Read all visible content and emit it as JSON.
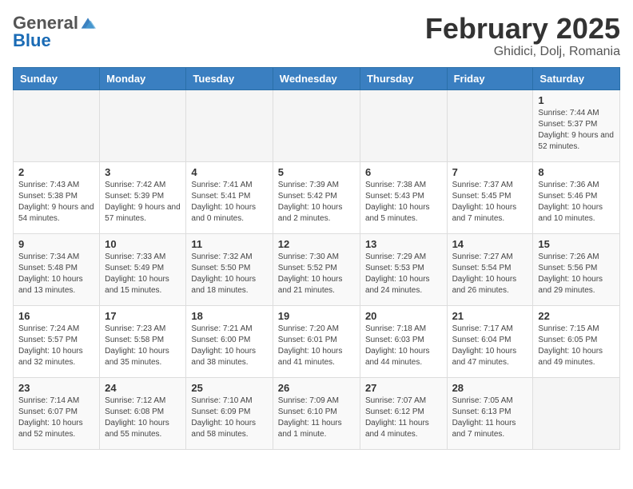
{
  "header": {
    "logo_general": "General",
    "logo_blue": "Blue",
    "month_title": "February 2025",
    "location": "Ghidici, Dolj, Romania"
  },
  "weekdays": [
    "Sunday",
    "Monday",
    "Tuesday",
    "Wednesday",
    "Thursday",
    "Friday",
    "Saturday"
  ],
  "weeks": [
    [
      {
        "day": "",
        "info": ""
      },
      {
        "day": "",
        "info": ""
      },
      {
        "day": "",
        "info": ""
      },
      {
        "day": "",
        "info": ""
      },
      {
        "day": "",
        "info": ""
      },
      {
        "day": "",
        "info": ""
      },
      {
        "day": "1",
        "info": "Sunrise: 7:44 AM\nSunset: 5:37 PM\nDaylight: 9 hours and 52 minutes."
      }
    ],
    [
      {
        "day": "2",
        "info": "Sunrise: 7:43 AM\nSunset: 5:38 PM\nDaylight: 9 hours and 54 minutes."
      },
      {
        "day": "3",
        "info": "Sunrise: 7:42 AM\nSunset: 5:39 PM\nDaylight: 9 hours and 57 minutes."
      },
      {
        "day": "4",
        "info": "Sunrise: 7:41 AM\nSunset: 5:41 PM\nDaylight: 10 hours and 0 minutes."
      },
      {
        "day": "5",
        "info": "Sunrise: 7:39 AM\nSunset: 5:42 PM\nDaylight: 10 hours and 2 minutes."
      },
      {
        "day": "6",
        "info": "Sunrise: 7:38 AM\nSunset: 5:43 PM\nDaylight: 10 hours and 5 minutes."
      },
      {
        "day": "7",
        "info": "Sunrise: 7:37 AM\nSunset: 5:45 PM\nDaylight: 10 hours and 7 minutes."
      },
      {
        "day": "8",
        "info": "Sunrise: 7:36 AM\nSunset: 5:46 PM\nDaylight: 10 hours and 10 minutes."
      }
    ],
    [
      {
        "day": "9",
        "info": "Sunrise: 7:34 AM\nSunset: 5:48 PM\nDaylight: 10 hours and 13 minutes."
      },
      {
        "day": "10",
        "info": "Sunrise: 7:33 AM\nSunset: 5:49 PM\nDaylight: 10 hours and 15 minutes."
      },
      {
        "day": "11",
        "info": "Sunrise: 7:32 AM\nSunset: 5:50 PM\nDaylight: 10 hours and 18 minutes."
      },
      {
        "day": "12",
        "info": "Sunrise: 7:30 AM\nSunset: 5:52 PM\nDaylight: 10 hours and 21 minutes."
      },
      {
        "day": "13",
        "info": "Sunrise: 7:29 AM\nSunset: 5:53 PM\nDaylight: 10 hours and 24 minutes."
      },
      {
        "day": "14",
        "info": "Sunrise: 7:27 AM\nSunset: 5:54 PM\nDaylight: 10 hours and 26 minutes."
      },
      {
        "day": "15",
        "info": "Sunrise: 7:26 AM\nSunset: 5:56 PM\nDaylight: 10 hours and 29 minutes."
      }
    ],
    [
      {
        "day": "16",
        "info": "Sunrise: 7:24 AM\nSunset: 5:57 PM\nDaylight: 10 hours and 32 minutes."
      },
      {
        "day": "17",
        "info": "Sunrise: 7:23 AM\nSunset: 5:58 PM\nDaylight: 10 hours and 35 minutes."
      },
      {
        "day": "18",
        "info": "Sunrise: 7:21 AM\nSunset: 6:00 PM\nDaylight: 10 hours and 38 minutes."
      },
      {
        "day": "19",
        "info": "Sunrise: 7:20 AM\nSunset: 6:01 PM\nDaylight: 10 hours and 41 minutes."
      },
      {
        "day": "20",
        "info": "Sunrise: 7:18 AM\nSunset: 6:03 PM\nDaylight: 10 hours and 44 minutes."
      },
      {
        "day": "21",
        "info": "Sunrise: 7:17 AM\nSunset: 6:04 PM\nDaylight: 10 hours and 47 minutes."
      },
      {
        "day": "22",
        "info": "Sunrise: 7:15 AM\nSunset: 6:05 PM\nDaylight: 10 hours and 49 minutes."
      }
    ],
    [
      {
        "day": "23",
        "info": "Sunrise: 7:14 AM\nSunset: 6:07 PM\nDaylight: 10 hours and 52 minutes."
      },
      {
        "day": "24",
        "info": "Sunrise: 7:12 AM\nSunset: 6:08 PM\nDaylight: 10 hours and 55 minutes."
      },
      {
        "day": "25",
        "info": "Sunrise: 7:10 AM\nSunset: 6:09 PM\nDaylight: 10 hours and 58 minutes."
      },
      {
        "day": "26",
        "info": "Sunrise: 7:09 AM\nSunset: 6:10 PM\nDaylight: 11 hours and 1 minute."
      },
      {
        "day": "27",
        "info": "Sunrise: 7:07 AM\nSunset: 6:12 PM\nDaylight: 11 hours and 4 minutes."
      },
      {
        "day": "28",
        "info": "Sunrise: 7:05 AM\nSunset: 6:13 PM\nDaylight: 11 hours and 7 minutes."
      },
      {
        "day": "",
        "info": ""
      }
    ]
  ]
}
